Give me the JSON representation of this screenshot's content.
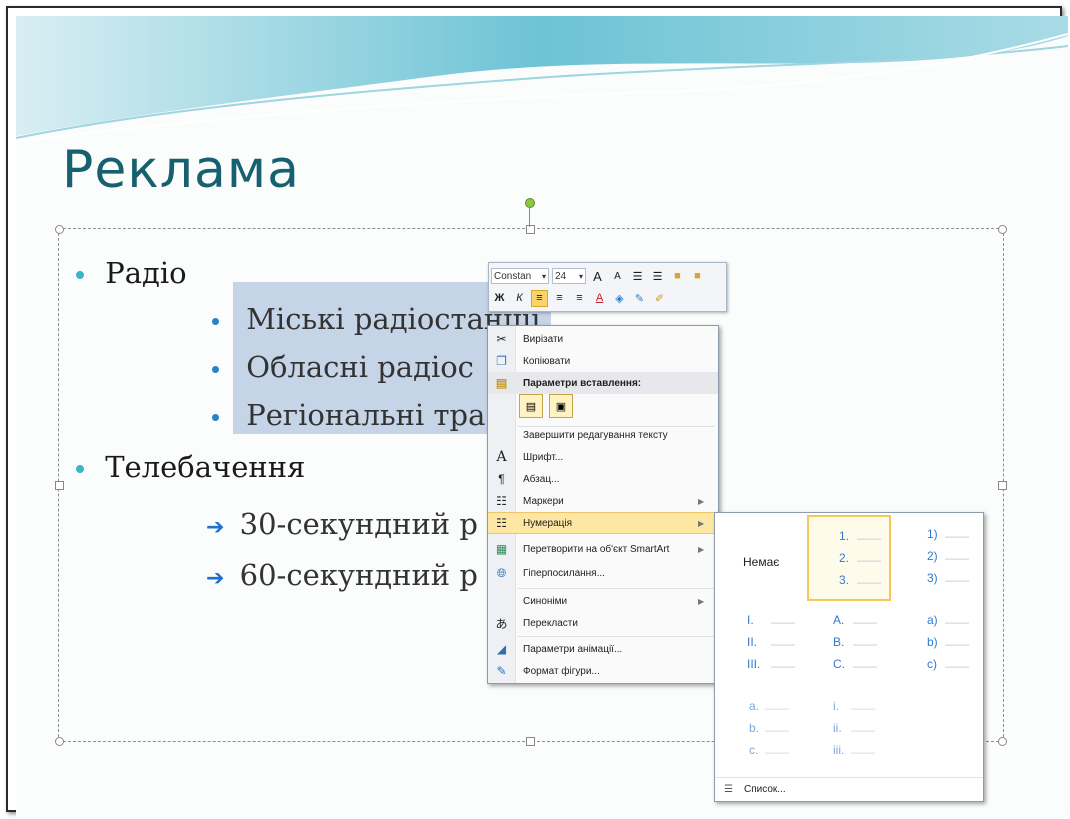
{
  "slide": {
    "title": "Реклама",
    "level1": [
      {
        "text": "Радіо"
      },
      {
        "text": "Телебачення"
      }
    ],
    "radio_items": [
      "Міські радіостанції",
      "Обласні радіос",
      "Регіональні тра"
    ],
    "tv_items": [
      "30-секундний р",
      "60-секундний р"
    ],
    "colors": {
      "title": "#16606f",
      "bullet": "#3bb5c9",
      "selection": "#c5d4e6"
    }
  },
  "mini_toolbar": {
    "font_name": "Constan",
    "font_size": "24",
    "grow_label": "A",
    "shrink_label": "A",
    "bold_label": "Ж",
    "italic_label": "К"
  },
  "context_menu": {
    "items": [
      {
        "label": "Вирізати",
        "icon": "scissors-icon"
      },
      {
        "label": "Копіювати",
        "icon": "copy-icon"
      },
      {
        "label": "Параметри вставлення:",
        "icon": "paste-icon"
      },
      {
        "label": "Завершити редагування тексту",
        "icon": ""
      },
      {
        "label": "Шрифт...",
        "icon": "font-icon"
      },
      {
        "label": "Абзац...",
        "icon": "paragraph-icon"
      },
      {
        "label": "Маркери",
        "icon": "bullets-icon"
      },
      {
        "label": "Нумерація",
        "icon": "numbering-icon"
      },
      {
        "label": "Перетворити на об'єкт SmartArt",
        "icon": "smartart-icon"
      },
      {
        "label": "Гіперпосилання...",
        "icon": "hyperlink-icon"
      },
      {
        "label": "Синоніми",
        "icon": ""
      },
      {
        "label": "Перекласти",
        "icon": "translate-icon"
      },
      {
        "label": "Параметри анімації...",
        "icon": "animation-icon"
      },
      {
        "label": "Формат фігури...",
        "icon": "format-shape-icon"
      }
    ]
  },
  "numbering_gallery": {
    "none_label": "Немає",
    "styles": [
      [
        "1.",
        "2.",
        "3."
      ],
      [
        "1)",
        "2)",
        "3)"
      ],
      [
        "I.",
        "II.",
        "III."
      ],
      [
        "A.",
        "B.",
        "C."
      ],
      [
        "a)",
        "b)",
        "c)"
      ],
      [
        "a.",
        "b.",
        "c."
      ],
      [
        "i.",
        "ii.",
        "iii."
      ]
    ],
    "footer_label": "Список..."
  }
}
